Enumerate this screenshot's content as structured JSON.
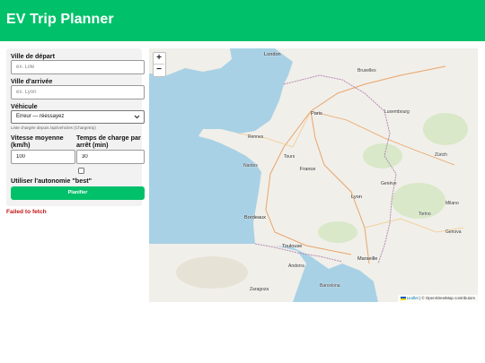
{
  "app": {
    "title": "EV Trip Planner"
  },
  "form": {
    "depart_label": "Ville de départ",
    "depart_placeholder": "ex. Lille",
    "depart_value": "",
    "arrivee_label": "Ville d'arrivée",
    "arrivee_placeholder": "ex. Lyon",
    "arrivee_value": "",
    "vehicle_label": "Véhicule",
    "vehicle_selected": "Erreur — réessayez",
    "vehicle_hint": "Liste chargée depuis /api/vehicles (Chargetrip)",
    "speed_label": "Vitesse moyenne (km/h)",
    "speed_value": "100",
    "charge_label": "Temps de charge par arrêt (min)",
    "charge_value": "30",
    "best_autonomy_label": "Utiliser l'autonomie \"best\"",
    "best_autonomy_checked": false,
    "submit_label": "Planifier"
  },
  "status": {
    "error": "Failed to fetch",
    "error_color": "#c01818"
  },
  "theme": {
    "accent": "#00c16a"
  },
  "map": {
    "zoom_in": "+",
    "zoom_out": "−",
    "attribution_leaflet": "Leaflet",
    "attribution_osm": "© OpenStreetMap contributors",
    "cities": [
      {
        "name": "Paris",
        "major": true
      },
      {
        "name": "London",
        "major": true
      },
      {
        "name": "Rennes",
        "major": false
      },
      {
        "name": "Nantes",
        "major": false
      },
      {
        "name": "Tours",
        "major": false
      },
      {
        "name": "France",
        "major": true
      },
      {
        "name": "Lyon",
        "major": true
      },
      {
        "name": "Bordeaux",
        "major": true
      },
      {
        "name": "Toulouse",
        "major": true
      },
      {
        "name": "Marseille",
        "major": true
      },
      {
        "name": "Genève",
        "major": false
      },
      {
        "name": "Luxembourg",
        "major": false
      },
      {
        "name": "Bruxelles",
        "major": false
      },
      {
        "name": "Zürich",
        "major": false
      },
      {
        "name": "Andorra",
        "major": false
      },
      {
        "name": "Zaragoza",
        "major": false
      },
      {
        "name": "Barcelona",
        "major": false
      },
      {
        "name": "Torino",
        "major": false
      },
      {
        "name": "Milano",
        "major": false
      },
      {
        "name": "Genova",
        "major": false
      }
    ]
  }
}
